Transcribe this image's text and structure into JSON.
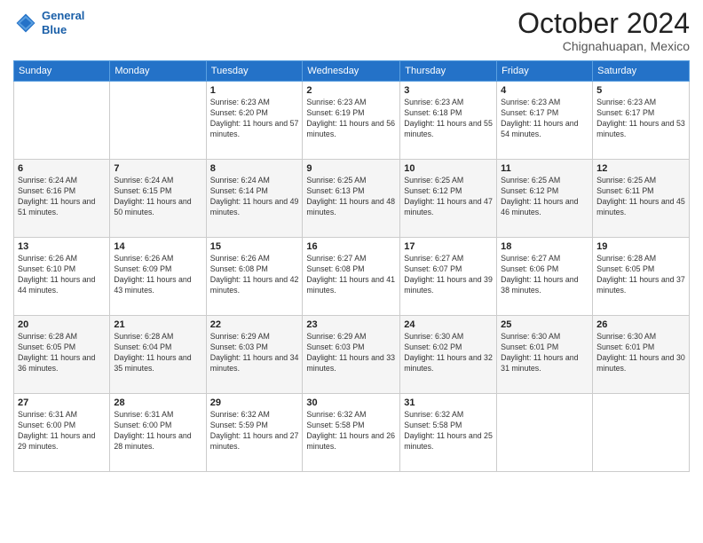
{
  "logo": {
    "line1": "General",
    "line2": "Blue"
  },
  "title": "October 2024",
  "location": "Chignahuapan, Mexico",
  "weekdays": [
    "Sunday",
    "Monday",
    "Tuesday",
    "Wednesday",
    "Thursday",
    "Friday",
    "Saturday"
  ],
  "weeks": [
    [
      {
        "day": "",
        "info": ""
      },
      {
        "day": "",
        "info": ""
      },
      {
        "day": "1",
        "info": "Sunrise: 6:23 AM\nSunset: 6:20 PM\nDaylight: 11 hours and 57 minutes."
      },
      {
        "day": "2",
        "info": "Sunrise: 6:23 AM\nSunset: 6:19 PM\nDaylight: 11 hours and 56 minutes."
      },
      {
        "day": "3",
        "info": "Sunrise: 6:23 AM\nSunset: 6:18 PM\nDaylight: 11 hours and 55 minutes."
      },
      {
        "day": "4",
        "info": "Sunrise: 6:23 AM\nSunset: 6:17 PM\nDaylight: 11 hours and 54 minutes."
      },
      {
        "day": "5",
        "info": "Sunrise: 6:23 AM\nSunset: 6:17 PM\nDaylight: 11 hours and 53 minutes."
      }
    ],
    [
      {
        "day": "6",
        "info": "Sunrise: 6:24 AM\nSunset: 6:16 PM\nDaylight: 11 hours and 51 minutes."
      },
      {
        "day": "7",
        "info": "Sunrise: 6:24 AM\nSunset: 6:15 PM\nDaylight: 11 hours and 50 minutes."
      },
      {
        "day": "8",
        "info": "Sunrise: 6:24 AM\nSunset: 6:14 PM\nDaylight: 11 hours and 49 minutes."
      },
      {
        "day": "9",
        "info": "Sunrise: 6:25 AM\nSunset: 6:13 PM\nDaylight: 11 hours and 48 minutes."
      },
      {
        "day": "10",
        "info": "Sunrise: 6:25 AM\nSunset: 6:12 PM\nDaylight: 11 hours and 47 minutes."
      },
      {
        "day": "11",
        "info": "Sunrise: 6:25 AM\nSunset: 6:12 PM\nDaylight: 11 hours and 46 minutes."
      },
      {
        "day": "12",
        "info": "Sunrise: 6:25 AM\nSunset: 6:11 PM\nDaylight: 11 hours and 45 minutes."
      }
    ],
    [
      {
        "day": "13",
        "info": "Sunrise: 6:26 AM\nSunset: 6:10 PM\nDaylight: 11 hours and 44 minutes."
      },
      {
        "day": "14",
        "info": "Sunrise: 6:26 AM\nSunset: 6:09 PM\nDaylight: 11 hours and 43 minutes."
      },
      {
        "day": "15",
        "info": "Sunrise: 6:26 AM\nSunset: 6:08 PM\nDaylight: 11 hours and 42 minutes."
      },
      {
        "day": "16",
        "info": "Sunrise: 6:27 AM\nSunset: 6:08 PM\nDaylight: 11 hours and 41 minutes."
      },
      {
        "day": "17",
        "info": "Sunrise: 6:27 AM\nSunset: 6:07 PM\nDaylight: 11 hours and 39 minutes."
      },
      {
        "day": "18",
        "info": "Sunrise: 6:27 AM\nSunset: 6:06 PM\nDaylight: 11 hours and 38 minutes."
      },
      {
        "day": "19",
        "info": "Sunrise: 6:28 AM\nSunset: 6:05 PM\nDaylight: 11 hours and 37 minutes."
      }
    ],
    [
      {
        "day": "20",
        "info": "Sunrise: 6:28 AM\nSunset: 6:05 PM\nDaylight: 11 hours and 36 minutes."
      },
      {
        "day": "21",
        "info": "Sunrise: 6:28 AM\nSunset: 6:04 PM\nDaylight: 11 hours and 35 minutes."
      },
      {
        "day": "22",
        "info": "Sunrise: 6:29 AM\nSunset: 6:03 PM\nDaylight: 11 hours and 34 minutes."
      },
      {
        "day": "23",
        "info": "Sunrise: 6:29 AM\nSunset: 6:03 PM\nDaylight: 11 hours and 33 minutes."
      },
      {
        "day": "24",
        "info": "Sunrise: 6:30 AM\nSunset: 6:02 PM\nDaylight: 11 hours and 32 minutes."
      },
      {
        "day": "25",
        "info": "Sunrise: 6:30 AM\nSunset: 6:01 PM\nDaylight: 11 hours and 31 minutes."
      },
      {
        "day": "26",
        "info": "Sunrise: 6:30 AM\nSunset: 6:01 PM\nDaylight: 11 hours and 30 minutes."
      }
    ],
    [
      {
        "day": "27",
        "info": "Sunrise: 6:31 AM\nSunset: 6:00 PM\nDaylight: 11 hours and 29 minutes."
      },
      {
        "day": "28",
        "info": "Sunrise: 6:31 AM\nSunset: 6:00 PM\nDaylight: 11 hours and 28 minutes."
      },
      {
        "day": "29",
        "info": "Sunrise: 6:32 AM\nSunset: 5:59 PM\nDaylight: 11 hours and 27 minutes."
      },
      {
        "day": "30",
        "info": "Sunrise: 6:32 AM\nSunset: 5:58 PM\nDaylight: 11 hours and 26 minutes."
      },
      {
        "day": "31",
        "info": "Sunrise: 6:32 AM\nSunset: 5:58 PM\nDaylight: 11 hours and 25 minutes."
      },
      {
        "day": "",
        "info": ""
      },
      {
        "day": "",
        "info": ""
      }
    ]
  ]
}
